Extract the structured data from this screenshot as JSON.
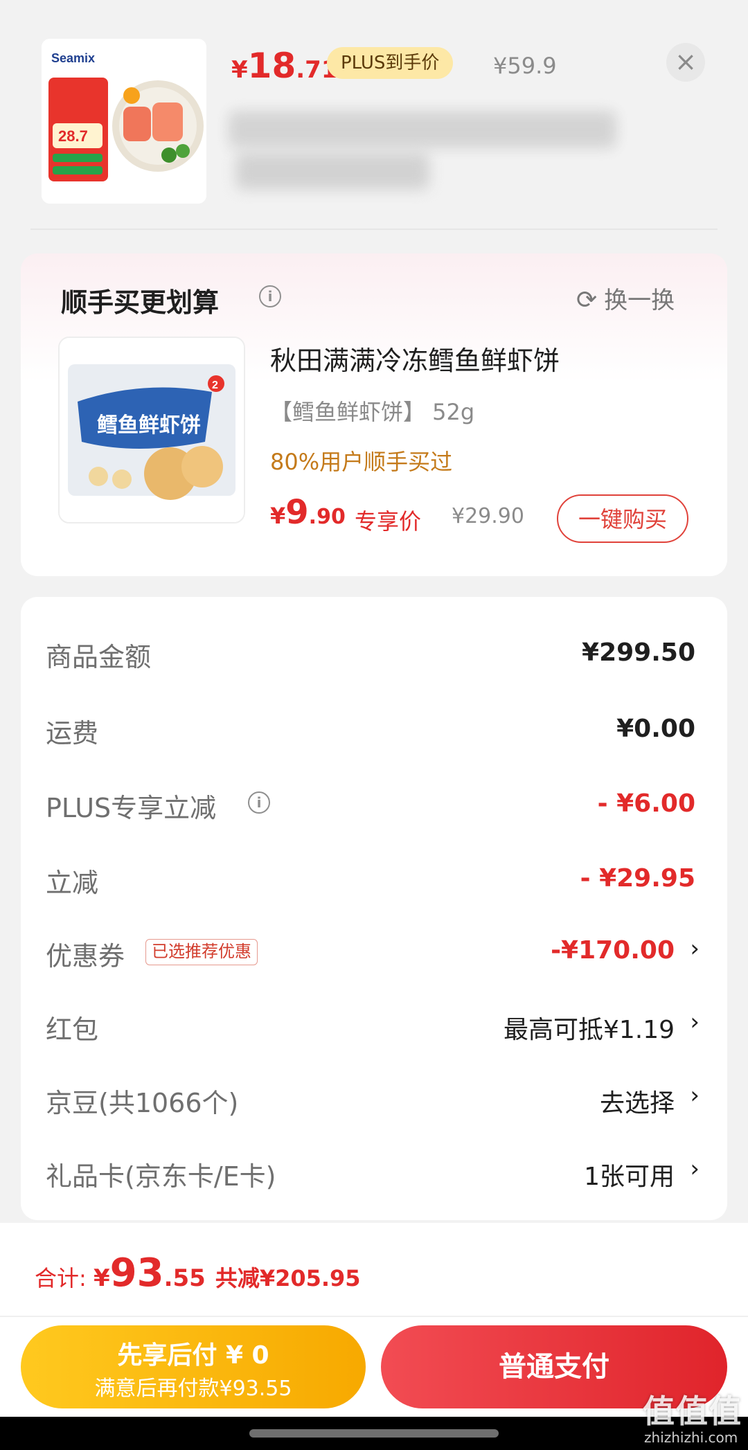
{
  "product": {
    "price_symbol": "¥",
    "price_int": "18",
    "price_dec": ".71",
    "plus_badge": "PLUS到手价",
    "original_price": "¥59.9",
    "close_label": "×",
    "thumb_brand": "Seamix",
    "thumb_price": "28.7"
  },
  "upsell": {
    "title": "顺手买更划算",
    "info_icon": "info-icon",
    "swap_label": "换一换",
    "swap_icon": "refresh-icon",
    "name": "秋田满满冷冻鳕鱼鲜虾饼",
    "spec": "【鳕鱼鲜虾饼】 52g",
    "buyers": "80%用户顺手买过",
    "price_symbol": "¥",
    "price_int": "9",
    "price_dec": ".90",
    "exclusive": "专享价",
    "original_price": "¥29.90",
    "buy_button": "一键购买",
    "thumb_label": "鳕鱼鲜虾饼",
    "thumb_num": "2"
  },
  "summary": {
    "rows": [
      {
        "label": "商品金额",
        "value": "¥299.50"
      },
      {
        "label": "运费",
        "value": "¥0.00"
      },
      {
        "label": "PLUS专享立减",
        "value": "- ¥6.00"
      },
      {
        "label": "立减",
        "value": "- ¥29.95"
      },
      {
        "label": "优惠券",
        "tag": "已选推荐优惠",
        "value": "-¥170.00"
      },
      {
        "label": "红包",
        "value": "最高可抵¥1.19"
      },
      {
        "label": "京豆(共1066个)",
        "value": "去选择"
      },
      {
        "label": "礼品卡(京东卡/E卡)",
        "value": "1张可用"
      }
    ],
    "chevron": "›"
  },
  "footer": {
    "total_label": "合计: ",
    "total_symbol": "¥",
    "total_int": "93",
    "total_dec": ".55",
    "savings": "共减¥205.95",
    "pay_later_title": "先享后付 ¥ 0",
    "pay_later_sub": "满意后再付款¥93.55",
    "pay_button": "普通支付"
  },
  "watermark": {
    "text": "值值值",
    "url": "zhizhizhi.com"
  },
  "colors": {
    "accent_red": "#e22a2a",
    "plus_gold": "#fde8a6",
    "pay_later_yellow": "#ffc91f"
  }
}
